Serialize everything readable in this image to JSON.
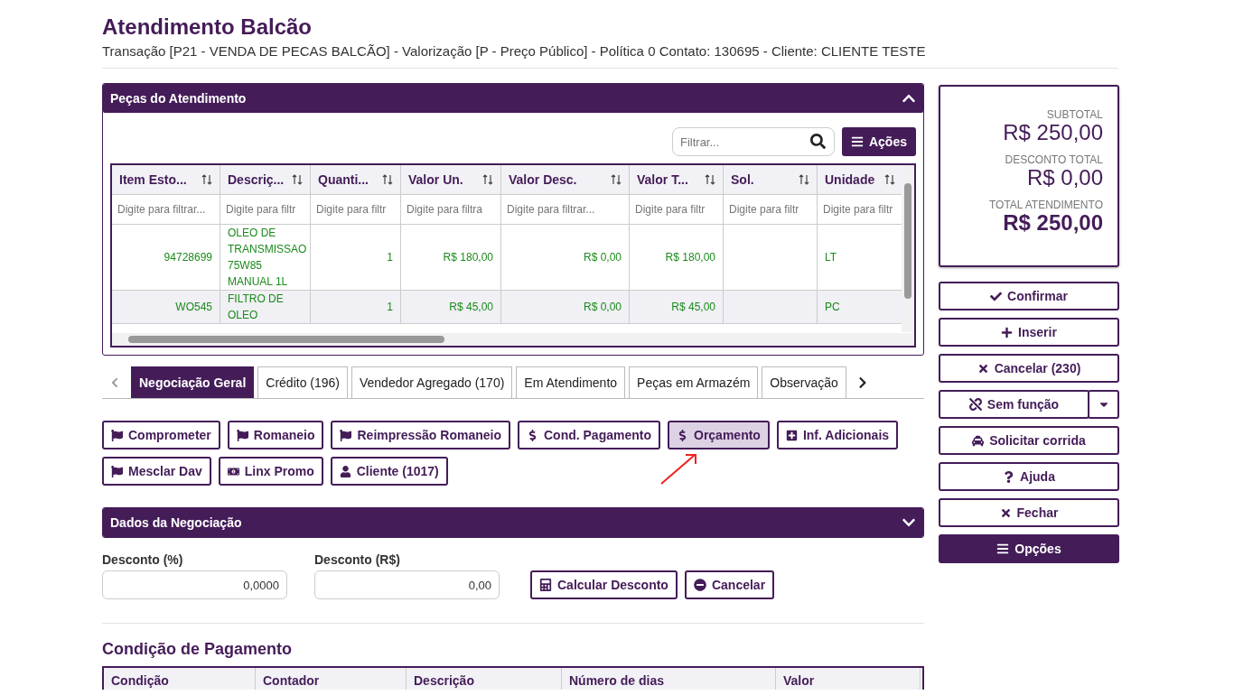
{
  "header": {
    "title": "Atendimento Balcão",
    "subtitle": "Transação [P21 - VENDA DE PECAS BALCÃO] - Valorização [P - Preço Público] - Política 0 Contato: 130695 - Cliente: CLIENTE TESTE"
  },
  "parts_panel": {
    "title": "Peças do Atendimento",
    "expanded": true,
    "filter_placeholder": "Filtrar...",
    "actions_button": "Ações",
    "columns": [
      {
        "label": "Item Esto...",
        "placeholder": "Digite para filtrar..."
      },
      {
        "label": "Descriç...",
        "placeholder": "Digite para filtr"
      },
      {
        "label": "Quanti...",
        "placeholder": "Digite para filtr"
      },
      {
        "label": "Valor Un.",
        "placeholder": "Digite para filtra"
      },
      {
        "label": "Valor Desc.",
        "placeholder": "Digite para filtrar..."
      },
      {
        "label": "Valor T...",
        "placeholder": "Digite para filtr"
      },
      {
        "label": "Sol.",
        "placeholder": "Digite para filtr"
      },
      {
        "label": "Unidade",
        "placeholder": "Digite para filtr"
      }
    ],
    "rows": [
      {
        "cells": [
          "94728699",
          "OLEO DE TRANSMISSAO 75W85 MANUAL 1L",
          "1",
          "R$ 180,00",
          "R$ 0,00",
          "R$ 180,00",
          null,
          "LT"
        ]
      },
      {
        "cells": [
          "WO545",
          "FILTRO DE OLEO",
          "1",
          "R$ 45,00",
          "R$ 0,00",
          "R$ 45,00",
          null,
          "PC"
        ]
      }
    ]
  },
  "tabs": [
    {
      "label": "Negociação Geral",
      "selected": true
    },
    {
      "label": "Crédito (196)",
      "selected": false
    },
    {
      "label": "Vendedor Agregado (170)",
      "selected": false
    },
    {
      "label": "Em Atendimento",
      "selected": false
    },
    {
      "label": "Peças em Armazém",
      "selected": false
    },
    {
      "label": "Observação",
      "selected": false
    }
  ],
  "action_buttons": [
    {
      "label": "Comprometer",
      "kind": "flag",
      "selected": false
    },
    {
      "label": "Romaneio",
      "kind": "flag",
      "selected": false
    },
    {
      "label": "Reimpressão Romaneio",
      "kind": "flag",
      "selected": false
    },
    {
      "label": "Cond. Pagamento",
      "kind": "dollar",
      "selected": false
    },
    {
      "label": "Orçamento",
      "kind": "dollar",
      "selected": true
    },
    {
      "label": "Inf. Adicionais",
      "kind": "add",
      "selected": false
    },
    {
      "label": "Mesclar Dav",
      "kind": "flag",
      "selected": false
    },
    {
      "label": "Linx Promo",
      "kind": "promo",
      "selected": false
    },
    {
      "label": "Cliente (1017)",
      "kind": "client",
      "selected": false
    }
  ],
  "negotiation_panel": {
    "title": "Dados da Negociação",
    "expanded": false,
    "fields": [
      {
        "label": "Desconto (%)",
        "value": "0,0000"
      },
      {
        "label": "Desconto (R$)",
        "value": "0,00"
      }
    ],
    "buttons": [
      {
        "label": "Calcular Desconto",
        "kind": "calculate"
      },
      {
        "label": "Cancelar",
        "kind": "cancel"
      }
    ]
  },
  "payment": {
    "title": "Condição de Pagamento",
    "columns": [
      "Condição",
      "Contador",
      "Descrição",
      "Número de dias",
      "Valor"
    ]
  },
  "summary": [
    {
      "label": "SUBTOTAL",
      "value": "R$ 250,00",
      "bold": false
    },
    {
      "label": "DESCONTO TOTAL",
      "value": "R$ 0,00",
      "bold": false
    },
    {
      "label": "TOTAL ATENDIMENTO",
      "value": "R$ 250,00",
      "bold": true
    }
  ],
  "side_buttons": [
    {
      "label": "Confirmar",
      "kind": "confirm"
    },
    {
      "label": "Inserir",
      "kind": "insert"
    },
    {
      "label": "Cancelar (230)",
      "kind": "cancel"
    },
    {
      "label": "Sem função",
      "kind": "split"
    },
    {
      "label": "Solicitar corrida",
      "kind": "ride"
    },
    {
      "label": "Ajuda",
      "kind": "help"
    },
    {
      "label": "Fechar",
      "kind": "close"
    },
    {
      "label": "Opções",
      "kind": "primary"
    }
  ]
}
